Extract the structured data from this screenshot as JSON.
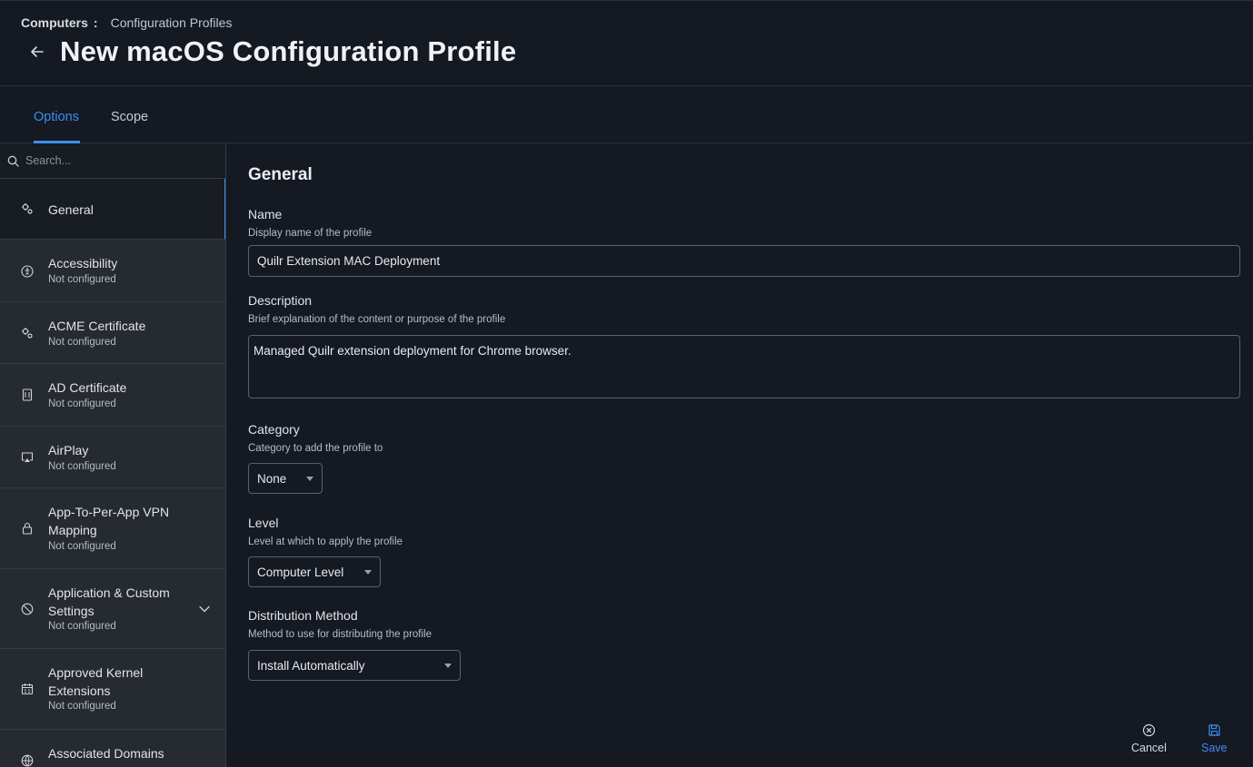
{
  "header": {
    "breadcrumb_root": "Computers",
    "breadcrumb_sep": ":",
    "breadcrumb_current": "Configuration Profiles",
    "title": "New macOS Configuration Profile"
  },
  "tabs": [
    {
      "label": "Options",
      "active": true
    },
    {
      "label": "Scope",
      "active": false
    }
  ],
  "sidebar": {
    "search_placeholder": "Search...",
    "items": [
      {
        "label": "General",
        "status": "",
        "icon": "gears-icon",
        "active": true
      },
      {
        "label": "Accessibility",
        "status": "Not configured",
        "icon": "accessibility-icon"
      },
      {
        "label": "ACME Certificate",
        "status": "Not configured",
        "icon": "gears-icon"
      },
      {
        "label": "AD Certificate",
        "status": "Not configured",
        "icon": "certificate-icon"
      },
      {
        "label": "AirPlay",
        "status": "Not configured",
        "icon": "airplay-icon"
      },
      {
        "label": "App-To-Per-App VPN Mapping",
        "status": "Not configured",
        "icon": "lock-icon"
      },
      {
        "label": "Application & Custom Settings",
        "status": "Not configured",
        "icon": "block-icon",
        "expandable": true
      },
      {
        "label": "Approved Kernel Extensions",
        "status": "Not configured",
        "icon": "calendar-icon"
      },
      {
        "label": "Associated Domains",
        "status": "",
        "icon": "globe-icon"
      }
    ]
  },
  "main": {
    "section_title": "General",
    "name": {
      "label": "Name",
      "help": "Display name of the profile",
      "value": "Quilr Extension MAC Deployment"
    },
    "description": {
      "label": "Description",
      "help": "Brief explanation of the content or purpose of the profile",
      "value": "Managed Quilr extension deployment for Chrome browser."
    },
    "category": {
      "label": "Category",
      "help": "Category to add the profile to",
      "value": "None"
    },
    "level": {
      "label": "Level",
      "help": "Level at which to apply the profile",
      "value": "Computer Level"
    },
    "distribution": {
      "label": "Distribution Method",
      "help": "Method to use for distributing the profile",
      "value": "Install Automatically"
    }
  },
  "actions": {
    "cancel": "Cancel",
    "save": "Save"
  },
  "colors": {
    "accent": "#3d8ef0",
    "background": "#141922",
    "sidebar": "#262a31"
  }
}
